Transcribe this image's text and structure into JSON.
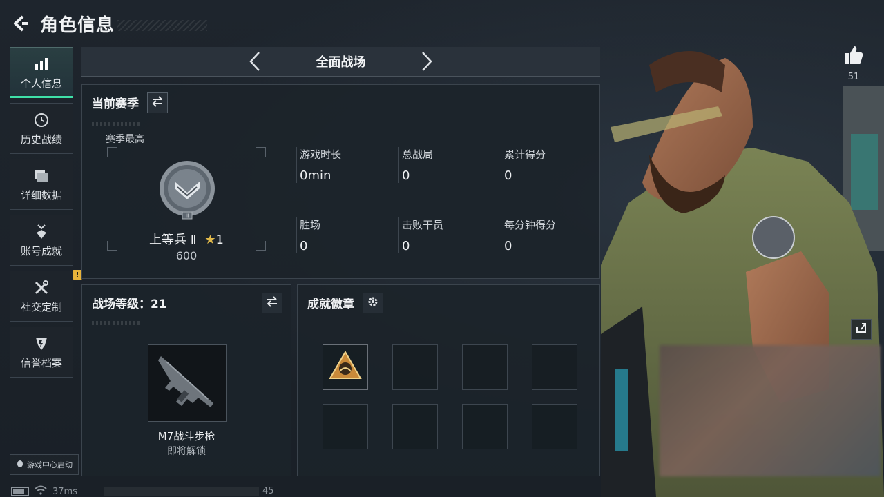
{
  "header": {
    "title": "角色信息"
  },
  "sidebar": {
    "items": [
      {
        "label": "个人信息",
        "icon": "bar-chart-icon",
        "active": true
      },
      {
        "label": "历史战绩",
        "icon": "clock-icon"
      },
      {
        "label": "详细数据",
        "icon": "folder-icon"
      },
      {
        "label": "账号成就",
        "icon": "medal-icon"
      },
      {
        "label": "社交定制",
        "icon": "tools-icon",
        "badge": "!"
      },
      {
        "label": "信誉档案",
        "icon": "shield-icon"
      }
    ],
    "launch_label": "游戏中心启动"
  },
  "mode": {
    "title": "全面战场"
  },
  "season": {
    "title": "当前赛季",
    "best_label": "赛季最高",
    "rank_name": "上等兵 Ⅱ",
    "rank_stars": "1",
    "rank_score": "600",
    "stats": [
      {
        "label": "游戏时长",
        "value": "0min"
      },
      {
        "label": "总战局",
        "value": "0"
      },
      {
        "label": "累计得分",
        "value": "0"
      },
      {
        "label": "胜场",
        "value": "0"
      },
      {
        "label": "击败干员",
        "value": "0"
      },
      {
        "label": "每分钟得分",
        "value": "0"
      }
    ]
  },
  "battlefield": {
    "level_label": "战场等级：",
    "level_value": "21",
    "weapon_name": "M7战斗步枪",
    "weapon_status": "即将解锁"
  },
  "badges": {
    "title": "成就徽章",
    "filled_index": 0
  },
  "right": {
    "like_count": "51"
  },
  "status": {
    "ping": "37ms",
    "number": "45"
  },
  "colors": {
    "accent": "#3fe0a8",
    "warning": "#e8b33a",
    "panel": "#1c232a"
  }
}
